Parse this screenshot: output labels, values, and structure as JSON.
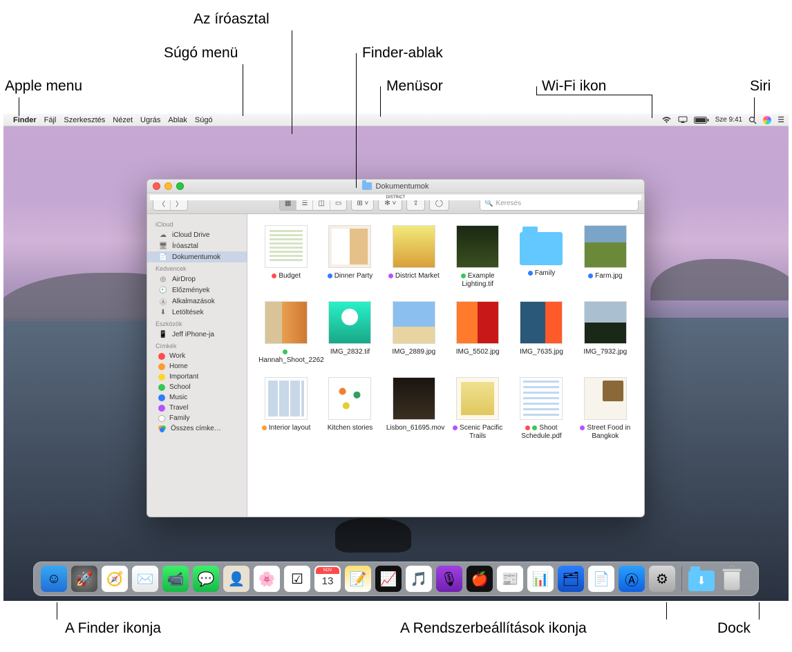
{
  "callouts": {
    "apple_menu": "Apple menu",
    "help_menu": "Súgó menü",
    "desktop": "Az íróasztal",
    "finder_window": "Finder-ablak",
    "menubar": "Menüsor",
    "wifi": "Wi-Fi ikon",
    "siri": "Siri",
    "finder_icon": "A Finder ikonja",
    "syspref_icon": "A Rendszerbeállítások ikonja",
    "dock": "Dock"
  },
  "menubar": {
    "app": "Finder",
    "items": [
      "Fájl",
      "Szerkesztés",
      "Nézet",
      "Ugrás",
      "Ablak",
      "Súgó"
    ],
    "clock": "Sze 9:41"
  },
  "finder": {
    "title": "Dokumentumok",
    "search_placeholder": "Keresés",
    "sidebar": {
      "icloud_header": "iCloud",
      "icloud": [
        {
          "label": "iCloud Drive",
          "icon": "cloud"
        },
        {
          "label": "Íróasztal",
          "icon": "desktop"
        },
        {
          "label": "Dokumentumok",
          "icon": "doc",
          "selected": true
        }
      ],
      "fav_header": "Kedvencek",
      "fav": [
        {
          "label": "AirDrop",
          "icon": "airdrop"
        },
        {
          "label": "Előzmények",
          "icon": "clock"
        },
        {
          "label": "Alkalmazások",
          "icon": "apps"
        },
        {
          "label": "Letöltések",
          "icon": "download"
        }
      ],
      "dev_header": "Eszközök",
      "dev": [
        {
          "label": "Jeff iPhone-ja",
          "icon": "phone"
        }
      ],
      "tags_header": "Címkék",
      "tags": [
        {
          "label": "Work",
          "color": "red"
        },
        {
          "label": "Home",
          "color": "orange"
        },
        {
          "label": "Important",
          "color": "yellow"
        },
        {
          "label": "School",
          "color": "green"
        },
        {
          "label": "Music",
          "color": "blue"
        },
        {
          "label": "Travel",
          "color": "purple"
        },
        {
          "label": "Family",
          "color": "grey"
        }
      ],
      "all_tags": "Összes címke…"
    },
    "files": [
      {
        "name": "Budget",
        "thumb": "th-doc",
        "tags": [
          "red"
        ]
      },
      {
        "name": "Dinner Party",
        "thumb": "th-dinner",
        "tags": [
          "blue"
        ]
      },
      {
        "name": "District Market",
        "thumb": "th-district",
        "tags": [
          "purple"
        ]
      },
      {
        "name": "Example Lighting.tif",
        "thumb": "th-example",
        "tags": [
          "green"
        ]
      },
      {
        "name": "Family",
        "thumb": "folder",
        "tags": [
          "blue"
        ]
      },
      {
        "name": "Farm.jpg",
        "thumb": "th-farm",
        "tags": [
          "blue"
        ]
      },
      {
        "name": "Hannah_Shoot_2262",
        "thumb": "th-hannah",
        "tags": [
          "green"
        ]
      },
      {
        "name": "IMG_2832.tif",
        "thumb": "th-img2832",
        "tags": []
      },
      {
        "name": "IMG_2889.jpg",
        "thumb": "th-img2889",
        "tags": []
      },
      {
        "name": "IMG_5502.jpg",
        "thumb": "th-img5502",
        "tags": []
      },
      {
        "name": "IMG_7635.jpg",
        "thumb": "th-img7635",
        "tags": []
      },
      {
        "name": "IMG_7932.jpg",
        "thumb": "th-img7932",
        "tags": []
      },
      {
        "name": "Interior layout",
        "thumb": "th-interior",
        "tags": [
          "orange"
        ]
      },
      {
        "name": "Kitchen stories",
        "thumb": "th-kitchen",
        "tags": []
      },
      {
        "name": "Lisbon_61695.mov",
        "thumb": "th-lisbon",
        "tags": []
      },
      {
        "name": "Scenic Pacific Trails",
        "thumb": "th-scenic",
        "tags": [
          "purple"
        ]
      },
      {
        "name": "Shoot Schedule.pdf",
        "thumb": "th-shoot",
        "tags": [
          "red",
          "green"
        ]
      },
      {
        "name": "Street Food in Bangkok",
        "thumb": "th-street",
        "tags": [
          "purple"
        ]
      }
    ]
  },
  "dock": {
    "apps": [
      {
        "name": "finder",
        "bg": "linear-gradient(#36a8f4,#1f6fd8)",
        "glyph": "☺"
      },
      {
        "name": "launchpad",
        "bg": "radial-gradient(circle,#888,#444)",
        "glyph": "🚀"
      },
      {
        "name": "safari",
        "bg": "#fff",
        "glyph": "🧭"
      },
      {
        "name": "mail",
        "bg": "linear-gradient(#fff,#e8e8e8)",
        "glyph": "✉️"
      },
      {
        "name": "facetime",
        "bg": "linear-gradient(#3cf06a,#18b848)",
        "glyph": "📹"
      },
      {
        "name": "messages",
        "bg": "linear-gradient(#3cf06a,#18b848)",
        "glyph": "💬"
      },
      {
        "name": "contacts",
        "bg": "#e8e0d0",
        "glyph": "👤"
      },
      {
        "name": "photos",
        "bg": "#fff",
        "glyph": "🌸"
      },
      {
        "name": "reminders",
        "bg": "#fff",
        "glyph": "☑"
      },
      {
        "name": "calendar",
        "bg": "#fff",
        "glyph": "13"
      },
      {
        "name": "notes",
        "bg": "linear-gradient(#ffe070,#fff)",
        "glyph": "📝"
      },
      {
        "name": "stocks",
        "bg": "#111",
        "glyph": "📈"
      },
      {
        "name": "music",
        "bg": "#fff",
        "glyph": "🎵"
      },
      {
        "name": "podcasts",
        "bg": "linear-gradient(#a040e0,#7020b0)",
        "glyph": "🎙"
      },
      {
        "name": "tv",
        "bg": "#111",
        "glyph": "🍎"
      },
      {
        "name": "news",
        "bg": "#fff",
        "glyph": "📰"
      },
      {
        "name": "numbers",
        "bg": "#fff",
        "glyph": "📊"
      },
      {
        "name": "keynote",
        "bg": "linear-gradient(#2a7fff,#1050c8)",
        "glyph": "🗂"
      },
      {
        "name": "pages",
        "bg": "#fff",
        "glyph": "📄"
      },
      {
        "name": "appstore",
        "bg": "linear-gradient(#2aa0ff,#1060e0)",
        "glyph": "Ⓐ"
      },
      {
        "name": "systempreferences",
        "bg": "linear-gradient(#d8d8d8,#a8a8a8)",
        "glyph": "⚙"
      }
    ]
  }
}
